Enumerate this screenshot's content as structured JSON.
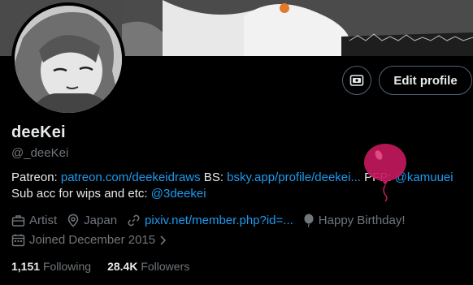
{
  "profile": {
    "display_name": "deeKei",
    "handle": "@_deeKei"
  },
  "actions": {
    "edit_profile_label": "Edit profile",
    "media_icon": "professional-tools-icon"
  },
  "bio": {
    "line1": {
      "patreon_label": "Patreon: ",
      "patreon_link": "patreon.com/deekeidraws",
      "bs_label": " BS: ",
      "bs_link": "bsky.app/profile/deekei...",
      "pfp_label": " PFP: ",
      "pfp_link": "@kamuuei"
    },
    "line2": {
      "sub_label": "Sub acc for wips and etc: ",
      "sub_link": "@3deekei"
    }
  },
  "meta": {
    "category": "Artist",
    "location": "Japan",
    "website": "pixiv.net/member.php?id=...",
    "birthday": "Happy Birthday!",
    "joined": "Joined December 2015"
  },
  "stats": {
    "following_count": "1,151",
    "following_label": "Following",
    "followers_count": "28.4K",
    "followers_label": "Followers"
  },
  "colors": {
    "background": "#000000",
    "text": "#e7e9ea",
    "secondary": "#71767b",
    "link": "#1d9bf0",
    "balloon": "#c2185b"
  }
}
